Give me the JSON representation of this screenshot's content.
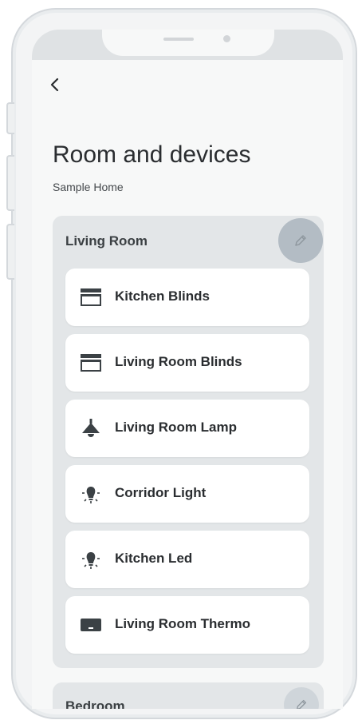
{
  "header": {
    "back_label": "<",
    "title": "Room and devices",
    "subtitle": "Sample Home"
  },
  "rooms": [
    {
      "name": "Living Room",
      "edit_icon": "pencil-icon",
      "devices": [
        {
          "label": "Kitchen Blinds",
          "icon": "blinds-icon"
        },
        {
          "label": "Living Room Blinds",
          "icon": "blinds-icon"
        },
        {
          "label": "Living Room Lamp",
          "icon": "ceiling-lamp-icon"
        },
        {
          "label": "Corridor Light",
          "icon": "bulb-icon"
        },
        {
          "label": "Kitchen Led",
          "icon": "bulb-icon"
        },
        {
          "label": "Living Room Thermo",
          "icon": "thermostat-icon"
        }
      ]
    },
    {
      "name": "Bedroom",
      "edit_icon": "pencil-icon"
    }
  ],
  "colors": {
    "card_bg": "#e3e6e8",
    "edit_button": "#b3bcc4",
    "icon_dark": "#3b4145"
  }
}
